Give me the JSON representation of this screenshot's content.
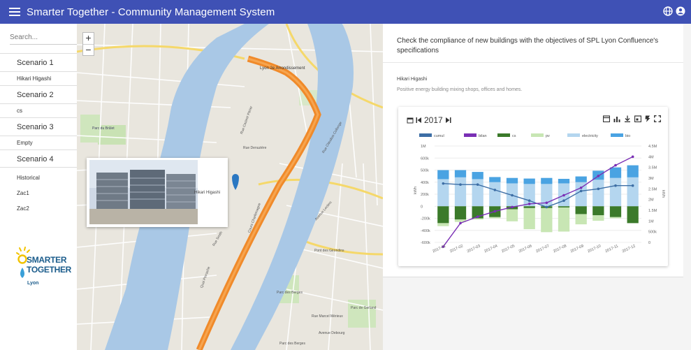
{
  "app": {
    "title": "Smarter Together - Community Management System"
  },
  "sidebar": {
    "search_placeholder": "Search...",
    "items": [
      {
        "label": "Scenario 1",
        "size": "big"
      },
      {
        "label": "Hikari Higashi",
        "size": "small"
      },
      {
        "label": "Scenario 2",
        "size": "big"
      },
      {
        "label": "cs",
        "size": "small"
      },
      {
        "label": "Scenario 3",
        "size": "big"
      },
      {
        "label": "Empty",
        "size": "small"
      },
      {
        "label": "Scenario 4",
        "size": "big"
      }
    ],
    "plain_items": [
      {
        "label": "Historical"
      },
      {
        "label": "Zac1"
      },
      {
        "label": "Zac2"
      }
    ],
    "logo": {
      "line1": "SMARTER",
      "line2": "TOGETHER",
      "line3": "Lyon"
    }
  },
  "map": {
    "zoom_in": "+",
    "zoom_out": "−",
    "popup_label": "Hikari Higashi",
    "labels": [
      "Lyon 2e Arrondissement",
      "Rue Casimir Périer",
      "Rue Claudius Collonge",
      "Parc du Brûlet",
      "Rue Denuzière",
      "Cours Charlemagne",
      "Rue Smith",
      "Quai Perrache",
      "Pont des Girondins",
      "Avenue Leclerc",
      "Parc des Berges",
      "Rue Marcel Mérieux",
      "Avenue Debourg",
      "Parc des Berges",
      "Parc de Gerland"
    ]
  },
  "panel": {
    "description": "Check the compliance of new buildings with the objectives of SPL Lyon Confluence's specifications",
    "person": "Hikari Higashi",
    "subtitle": "Positive energy building mixing shops, offices and homes.",
    "year": "2017"
  },
  "colors": {
    "topbar": "#3f51b5",
    "cumul": "#3d6ea5",
    "bilan": "#7a2fb5",
    "cs": "#3b7a2a",
    "pv": "#c8e6b4",
    "electricity": "#b4d6ef",
    "bio": "#4aa3e2"
  },
  "chart_data": {
    "type": "bar",
    "categories": [
      "2017-01",
      "2017-02",
      "2017-03",
      "2017-04",
      "2017-05",
      "2017-06",
      "2017-07",
      "2017-08",
      "2017-09",
      "2017-10",
      "2017-11",
      "2017-12"
    ],
    "series": [
      {
        "name": "electricity",
        "values": [
          450000,
          480000,
          450000,
          400000,
          380000,
          370000,
          370000,
          380000,
          400000,
          440000,
          470000,
          480000
        ]
      },
      {
        "name": "bio",
        "values": [
          150000,
          120000,
          120000,
          85000,
          90000,
          90000,
          100000,
          75000,
          95000,
          150000,
          175000,
          200000
        ]
      },
      {
        "name": "pv",
        "values": [
          -330000,
          -260000,
          -220000,
          -200000,
          -250000,
          -380000,
          -430000,
          -420000,
          -300000,
          -240000,
          -200000,
          -250000
        ]
      },
      {
        "name": "cs",
        "values": [
          -280000,
          -220000,
          -200000,
          -180000,
          -50000,
          -30000,
          -30000,
          -20000,
          -130000,
          -150000,
          -180000,
          -280000
        ]
      },
      {
        "name": "cumul",
        "values": [
          2750000,
          2700000,
          2700000,
          2450000,
          2200000,
          1950000,
          1650000,
          1950000,
          2400000,
          2500000,
          2650000,
          2650000
        ]
      },
      {
        "name": "bilan",
        "values": [
          -200000,
          900000,
          1200000,
          1450000,
          1650000,
          1800000,
          1850000,
          2200000,
          2550000,
          3100000,
          3600000,
          4000000
        ]
      }
    ],
    "legend": [
      "cumul",
      "bilan",
      "cs",
      "pv",
      "electricity",
      "bio"
    ],
    "y_left_ticks": [
      "-600k",
      "-400k",
      "-200k",
      "0",
      "200k",
      "400k",
      "500k",
      "600k",
      "1M"
    ],
    "y_right_ticks": [
      "0",
      "500k",
      "1M",
      "1.5M",
      "2M",
      "2.5M",
      "3M",
      "3.5M",
      "4M",
      "4.5M"
    ],
    "ylabel_left": "kWh",
    "ylabel_right": "kWh",
    "ylim_left": [
      -600000,
      1000000
    ],
    "ylim_right": [
      0,
      4500000
    ]
  }
}
